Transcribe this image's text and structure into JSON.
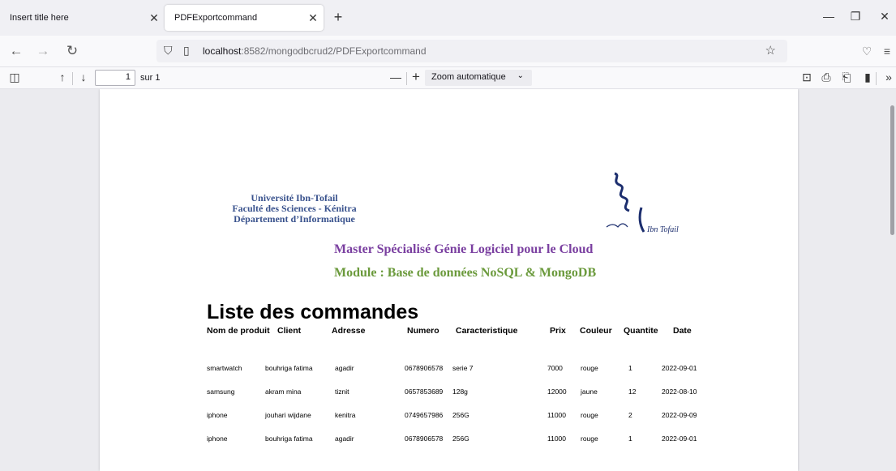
{
  "tabs": [
    {
      "label": "Insert title here",
      "active": false
    },
    {
      "label": "PDFExportcommand",
      "active": true
    }
  ],
  "new_tab_label": "+",
  "window_controls": {
    "minimize": "—",
    "restore": "❐",
    "close": "✕"
  },
  "nav": {
    "url_host": "localhost",
    "url_path": ":8582/mongodbcrud2/PDFExportcommand"
  },
  "pdf_toolbar": {
    "page_value": "1",
    "page_count": "sur 1",
    "zoom_value": "Zoom automatique",
    "zoom_minus": "—",
    "zoom_plus": "+"
  },
  "document": {
    "university_lines": [
      "Université Ibn-Tofail",
      "Faculté des Sciences - Kénitra",
      "Département d’Informatique"
    ],
    "logo_text": "Ibn Tofail",
    "master_title": "Master Spécialisé Génie Logiciel pour le Cloud",
    "module_title": "Module : Base de données NoSQL & MongoDB",
    "list_title": "Liste des commandes",
    "table": {
      "headers": [
        "Nom de produit",
        "Client",
        "Adresse",
        "Numero",
        "Caracteristique",
        "Prix",
        "Couleur",
        "Quantite",
        "Date"
      ],
      "rows": [
        [
          "smartwatch",
          "bouhriga fatima",
          "agadir",
          "0678906578",
          "serie 7",
          "7000",
          "rouge",
          "1",
          "2022-09-01"
        ],
        [
          "samsung",
          "akram mina",
          "tiznit",
          "0657853689",
          "128g",
          "12000",
          "jaune",
          "12",
          "2022-08-10"
        ],
        [
          "iphone",
          "jouhari wijdane",
          "kenitra",
          "0749657986",
          "256G",
          "11000",
          "rouge",
          "2",
          "2022-09-09"
        ],
        [
          "iphone",
          "bouhriga fatima",
          "agadir",
          "0678906578",
          "256G",
          "11000",
          "rouge",
          "1",
          "2022-09-01"
        ]
      ]
    }
  },
  "icons": {
    "back": "back-arrow-icon",
    "forward": "forward-arrow-icon",
    "reload": "reload-icon",
    "shield": "shield-icon",
    "page": "page-icon",
    "star": "bookmark-star-icon",
    "pocket": "pocket-icon",
    "menu": "hamburger-menu-icon"
  }
}
